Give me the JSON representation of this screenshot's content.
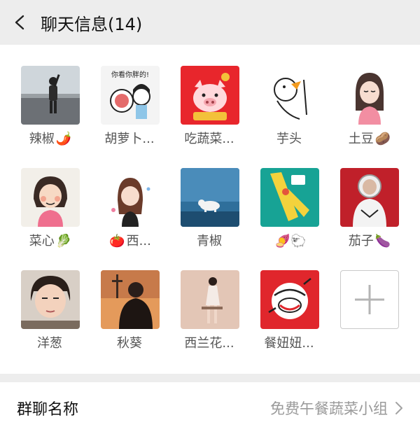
{
  "header": {
    "title": "聊天信息(14)"
  },
  "members": [
    {
      "name": "辣椒",
      "emoji": "🌶️"
    },
    {
      "name": "胡萝卜...",
      "emoji": ""
    },
    {
      "name": "吃蔬菜...",
      "emoji": ""
    },
    {
      "name": "芋头",
      "emoji": ""
    },
    {
      "name": "土豆",
      "emoji": "🥔"
    },
    {
      "name": "菜心",
      "emoji": "🥬"
    },
    {
      "name": "西...",
      "emoji": "🍅"
    },
    {
      "name": "青椒",
      "emoji": ""
    },
    {
      "name": "",
      "emoji": "🍠🐑"
    },
    {
      "name": "茄子",
      "emoji": "🍆"
    },
    {
      "name": "洋葱",
      "emoji": ""
    },
    {
      "name": "秋葵",
      "emoji": ""
    },
    {
      "name": "西兰花...",
      "emoji": ""
    },
    {
      "name": "餐妞妞...",
      "emoji": ""
    }
  ],
  "group_name": {
    "label": "群聊名称",
    "value": "免费午餐蔬菜小组"
  },
  "avatar_stickers": {
    "sticker_2": "你看你胖的!"
  }
}
